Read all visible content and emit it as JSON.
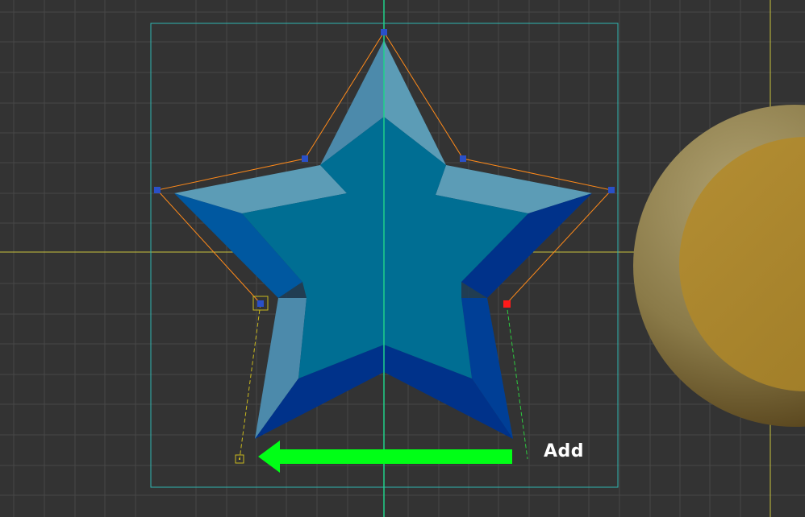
{
  "viewport": {
    "background_color": "#333333",
    "grid_color": "#474747",
    "selection_box_color": "#2fb6b0",
    "center_axis_color": "#1fd18a",
    "guide_color": "#c9c33c"
  },
  "star": {
    "fill_color": "#006e93",
    "bevel_light_color": "#5c9cb6",
    "bevel_dark_color": "#00328a",
    "outline_color": "#ff8a1a",
    "vertex_color": "#2a50c8",
    "selected_vertex_color": "#ff1a1a"
  },
  "handles": {
    "left_handle_color": "#c9b81e",
    "right_handle_color": "#2ecc40"
  },
  "coin": {
    "outer_color": "#8a7a48",
    "inner_color": "#a9862e"
  },
  "annotation": {
    "arrow_color": "#00ff16",
    "label": "Add"
  }
}
